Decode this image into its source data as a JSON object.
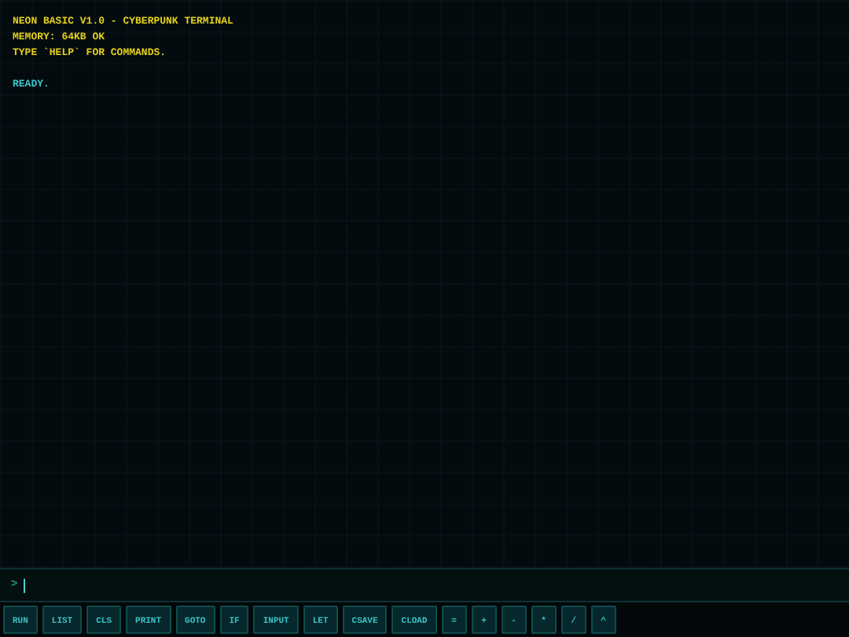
{
  "output": [
    {
      "text": "NEON BASIC V1.0 - CYBERPUNK TERMINAL",
      "kind": "system"
    },
    {
      "text": "MEMORY: 64KB OK",
      "kind": "system"
    },
    {
      "text": "TYPE `HELP` FOR COMMANDS.",
      "kind": "system"
    },
    {
      "kind": "blank"
    },
    {
      "text": "READY.",
      "kind": "status"
    }
  ],
  "prompt": {
    "symbol": ">"
  },
  "keys": [
    "RUN",
    "LIST",
    "CLS",
    "PRINT",
    "GOTO",
    "IF",
    "INPUT",
    "LET",
    "CSAVE",
    "CLOAD",
    "=",
    "+",
    "-",
    "*",
    "/",
    "^"
  ]
}
